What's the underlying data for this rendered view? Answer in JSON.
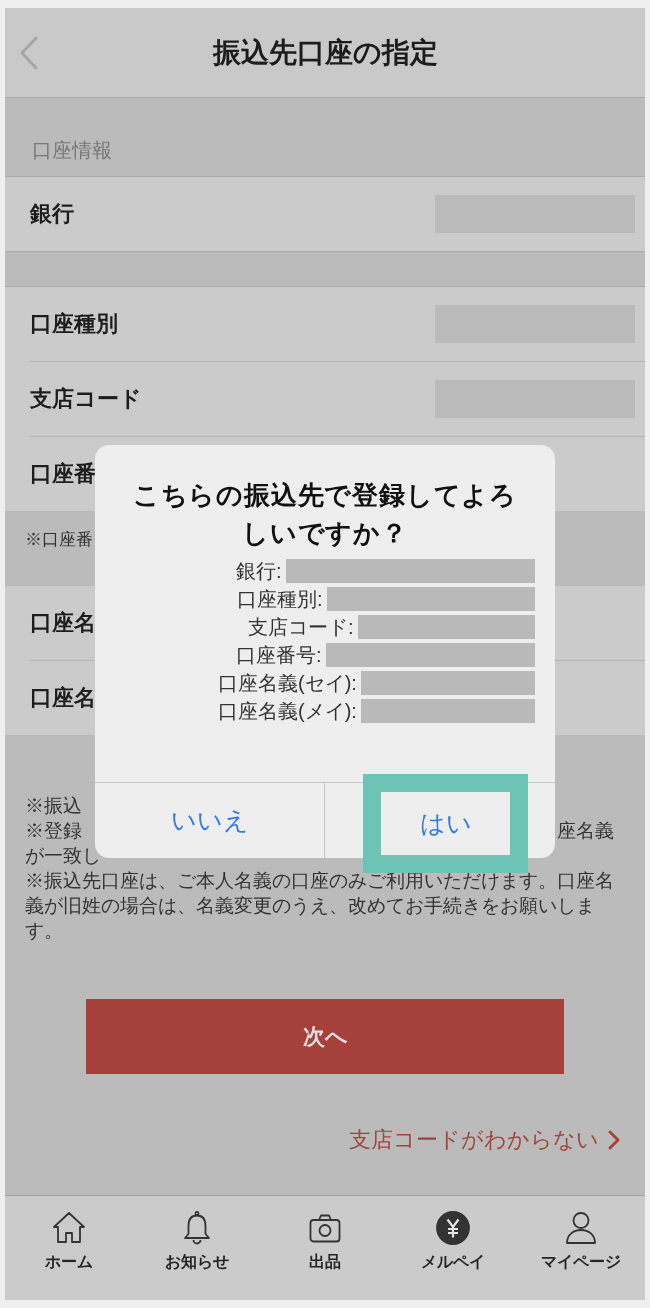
{
  "header": {
    "title": "振込先口座の指定"
  },
  "form": [
    {
      "kind": "section",
      "label": "口座情報"
    },
    {
      "kind": "field",
      "label": "銀行",
      "masked": true
    },
    {
      "kind": "spacer"
    },
    {
      "kind": "field",
      "label": "口座種別",
      "masked": true
    },
    {
      "kind": "field",
      "label": "支店コード",
      "masked": true
    },
    {
      "kind": "field",
      "label": "口座番",
      "masked": false
    },
    {
      "kind": "note",
      "label": "※口座番"
    },
    {
      "kind": "field",
      "label": "口座名",
      "masked": false
    },
    {
      "kind": "field",
      "label": "口座名",
      "masked": false
    }
  ],
  "notes": [
    {
      "kind": "covered",
      "left": "※振込"
    },
    {
      "kind": "covered",
      "left": "※登録",
      "right": "座名義"
    },
    {
      "kind": "covered",
      "left": "が一致し"
    },
    {
      "kind": "full",
      "text": "※振込先口座は、ご本人名義の口座のみご利用いただけます。口座名義が旧姓の場合は、名義変更のうえ、改めてお手続きをお願いします。"
    }
  ],
  "next_button": {
    "label": "次へ"
  },
  "help_link": {
    "label": "支店コードがわからない"
  },
  "tab_bar": [
    {
      "label": "ホーム",
      "selected": false
    },
    {
      "label": "お知らせ",
      "selected": false
    },
    {
      "label": "出品",
      "selected": false
    },
    {
      "label": "メルペイ",
      "selected": true
    },
    {
      "label": "マイページ",
      "selected": false
    }
  ],
  "dialog": {
    "title": "こちらの振込先で登録してよろしいですか？",
    "details": [
      {
        "label": "銀行:",
        "masked": true
      },
      {
        "label": "口座種別:",
        "masked": true
      },
      {
        "label": "支店コード:",
        "masked": true
      },
      {
        "label": "口座番号:",
        "masked": true
      },
      {
        "label": "口座名義(セイ):",
        "masked": true
      },
      {
        "label": "口座名義(メイ):",
        "masked": true
      }
    ],
    "buttons": [
      {
        "label": "いいえ",
        "highlighted": false
      },
      {
        "label": "はい",
        "highlighted": true
      }
    ]
  }
}
